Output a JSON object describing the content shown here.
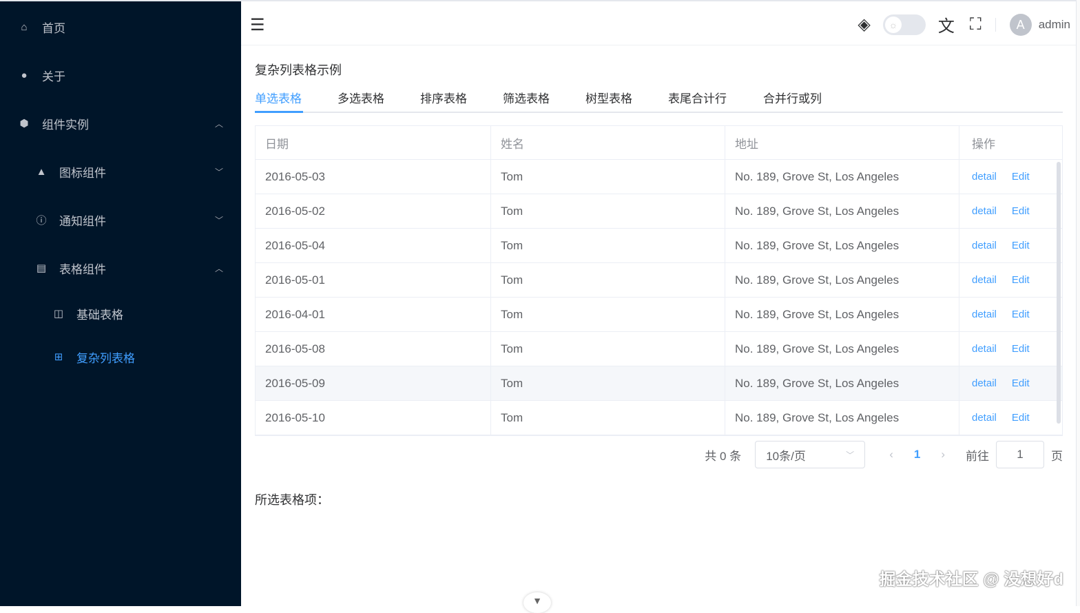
{
  "sidebar": {
    "items": [
      {
        "label": "首页",
        "icon": "home-icon"
      },
      {
        "label": "关于",
        "icon": "user-icon"
      },
      {
        "label": "组件实例",
        "icon": "cube-icon"
      },
      {
        "label": "图标组件",
        "icon": "shapes-icon"
      },
      {
        "label": "通知组件",
        "icon": "info-icon"
      },
      {
        "label": "表格组件",
        "icon": "table-icon"
      },
      {
        "label": "基础表格",
        "icon": "table-icon"
      },
      {
        "label": "复杂列表格",
        "icon": "grid-icon"
      }
    ]
  },
  "header": {
    "user": "admin",
    "avatar_letter": "A"
  },
  "page": {
    "title": "复杂列表格示例",
    "tabs": [
      "单选表格",
      "多选表格",
      "排序表格",
      "筛选表格",
      "树型表格",
      "表尾合计行",
      "合并行或列"
    ]
  },
  "table": {
    "columns": [
      "日期",
      "姓名",
      "地址",
      "操作"
    ],
    "rows": [
      {
        "date": "2016-05-03",
        "name": "Tom",
        "address": "No. 189, Grove St, Los Angeles"
      },
      {
        "date": "2016-05-02",
        "name": "Tom",
        "address": "No. 189, Grove St, Los Angeles"
      },
      {
        "date": "2016-05-04",
        "name": "Tom",
        "address": "No. 189, Grove St, Los Angeles"
      },
      {
        "date": "2016-05-01",
        "name": "Tom",
        "address": "No. 189, Grove St, Los Angeles"
      },
      {
        "date": "2016-04-01",
        "name": "Tom",
        "address": "No. 189, Grove St, Los Angeles"
      },
      {
        "date": "2016-05-08",
        "name": "Tom",
        "address": "No. 189, Grove St, Los Angeles"
      },
      {
        "date": "2016-05-09",
        "name": "Tom",
        "address": "No. 189, Grove St, Los Angeles"
      },
      {
        "date": "2016-05-10",
        "name": "Tom",
        "address": "No. 189, Grove St, Los Angeles"
      }
    ],
    "actions": [
      "detail",
      "Edit"
    ]
  },
  "pagination": {
    "total": "共 0 条",
    "page_size": "10条/页",
    "current": "1",
    "goto_label": "前往",
    "goto_value": "1",
    "page_unit": "页"
  },
  "selected_label": "所选表格项：",
  "watermark": "掘金技术社区 @ 没想好d",
  "colors": {
    "sidebar": "#001529",
    "accent": "#409eff"
  }
}
